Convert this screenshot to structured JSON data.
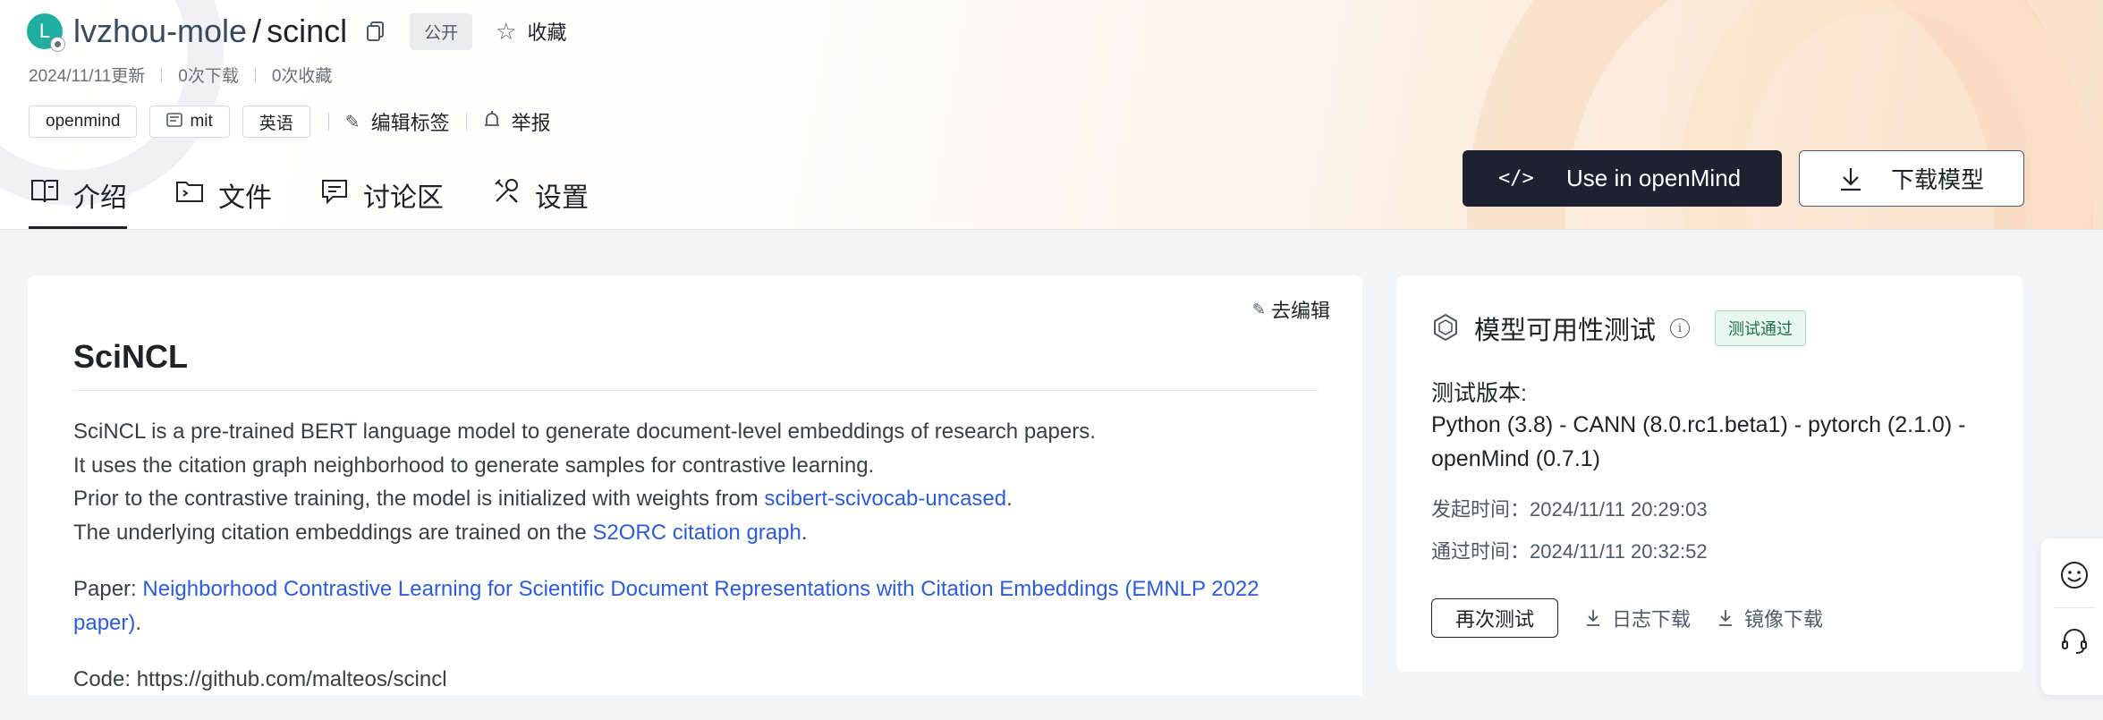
{
  "header": {
    "avatar_letter": "L",
    "owner": "lvzhou-mole",
    "slash": "/",
    "repo": "scincl",
    "visibility": "公开",
    "favorite_label": "收藏",
    "updated": "2024/11/11更新",
    "downloads": "0次下载",
    "favorites": "0次收藏"
  },
  "tags": [
    {
      "label": "openmind"
    },
    {
      "label": "mit",
      "icon": "license-icon"
    },
    {
      "label": "英语"
    }
  ],
  "actions": {
    "edit_tags": "编辑标签",
    "report": "举报"
  },
  "tabs": [
    {
      "label": "介绍",
      "icon": "intro-book-icon",
      "active": true
    },
    {
      "label": "文件",
      "icon": "folder-icon",
      "active": false
    },
    {
      "label": "讨论区",
      "icon": "discussion-icon",
      "active": false
    },
    {
      "label": "设置",
      "icon": "settings-tools-icon",
      "active": false
    }
  ],
  "buttons": {
    "use_openmind": "Use in openMind",
    "download_model": "下载模型"
  },
  "doc": {
    "edit_link": "去编辑",
    "title": "SciNCL",
    "line1": "SciNCL is a pre-trained BERT language model to generate document-level embeddings of research papers.",
    "line2": "It uses the citation graph neighborhood to generate samples for contrastive learning.",
    "line3_pre": "Prior to the contrastive training, the model is initialized with weights from ",
    "line3_link": "scibert-scivocab-uncased",
    "line3_post": ".",
    "line4_pre": "The underlying citation embeddings are trained on the ",
    "line4_link": "S2ORC citation graph",
    "line4_post": ".",
    "paper_pre": "Paper: ",
    "paper_link": "Neighborhood Contrastive Learning for Scientific Document Representations with Citation Embeddings (EMNLP 2022 paper)",
    "paper_post": ".",
    "code": "Code: https://github.com/malteos/scincl"
  },
  "side": {
    "title": "模型可用性测试",
    "info": "i",
    "status": "测试通过",
    "version_label": "测试版本:",
    "version": "Python (3.8) - CANN (8.0.rc1.beta1) - pytorch (2.1.0) - openMind (0.7.1)",
    "start_time": "发起时间：2024/11/11 20:29:03",
    "pass_time": "通过时间：2024/11/11 20:32:52",
    "retest": "再次测试",
    "log_download": "日志下载",
    "image_download": "镜像下载"
  },
  "colors": {
    "accent_dark": "#1d2230",
    "link": "#2e5cd6",
    "pass_bg": "#e8f7ef",
    "avatar": "#1fae9f"
  }
}
